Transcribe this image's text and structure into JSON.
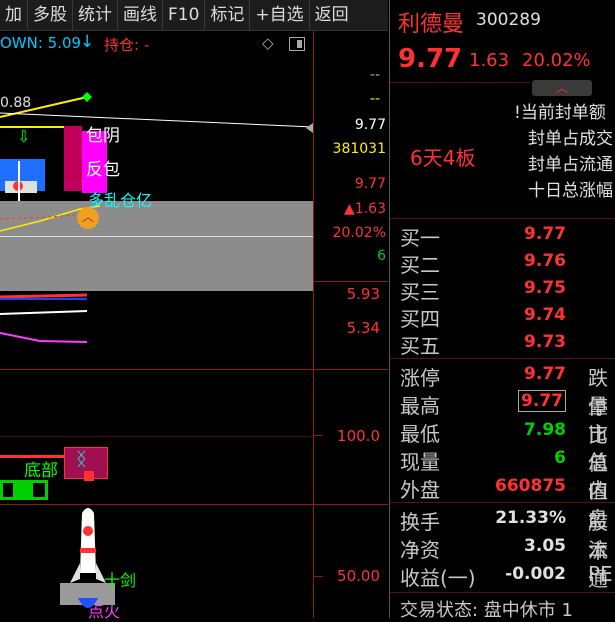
{
  "toolbar": {
    "items": [
      "加",
      "多股",
      "统计",
      "画线",
      "F10",
      "标记",
      "+自选",
      "返回"
    ]
  },
  "chart": {
    "indicator_label": "OWN: 5.09",
    "holding_label": "持仓: -",
    "left_value": "0.88",
    "label_baoyin": "包阴",
    "label_fanbao": "反包",
    "label_duoshu": "多乱仓亿",
    "label_dibu": "底部",
    "label_jian": "十剑",
    "label_dianhuo": "点火",
    "axis": {
      "top_dash1": "--",
      "top_dash2": "--",
      "price": "9.77",
      "volume": "381031",
      "price2": "9.77",
      "change": "▲1.63",
      "pct": "20.02%",
      "six": "6",
      "v593": "5.93",
      "v534": "5.34",
      "v100": "100.0",
      "v50": "50.00"
    },
    "colors": {
      "grid": "#8b1a1a",
      "up": "#ff3232",
      "down": "#00d000"
    }
  },
  "panel": {
    "stock_name": "利德曼",
    "stock_code": "300289",
    "price": "9.77",
    "change": "1.63",
    "pct": "20.02%",
    "board": "6天4板",
    "info": [
      "!当前封单额",
      "封单占成交",
      "封单占流通",
      "十日总涨幅"
    ],
    "orderbook": [
      {
        "label": "买一",
        "value": "9.77"
      },
      {
        "label": "买二",
        "value": "9.76"
      },
      {
        "label": "买三",
        "value": "9.75"
      },
      {
        "label": "买四",
        "value": "9.74"
      },
      {
        "label": "买五",
        "value": "9.73"
      }
    ],
    "stats": [
      {
        "label": "涨停",
        "value": "9.77",
        "right": "跌停"
      },
      {
        "label": "最高",
        "value": "9.77",
        "right": "量比"
      },
      {
        "label": "最低",
        "value": "7.98",
        "right": "市值"
      },
      {
        "label": "现量",
        "value": "6",
        "right": "总值"
      },
      {
        "label": "外盘",
        "value": "660875",
        "right": "内盘"
      }
    ],
    "finance": [
      {
        "label": "换手",
        "value": "21.33%",
        "right": "股本"
      },
      {
        "label": "净资",
        "value": "3.05",
        "right": "流通"
      },
      {
        "label": "收益(一)",
        "value": "-0.002",
        "right": "PE"
      }
    ],
    "status": "交易状态: 盘中休市 1"
  }
}
